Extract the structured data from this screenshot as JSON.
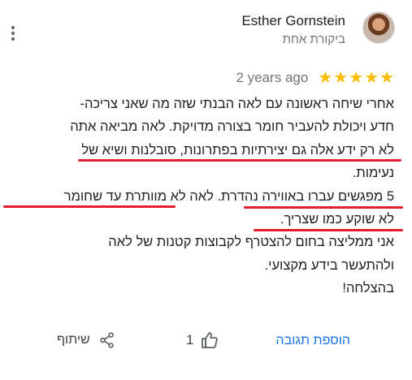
{
  "menu": {
    "icon": "more-vert-icon"
  },
  "author": {
    "name": "Esther Gornstein",
    "meta": "ביקורת אחת",
    "avatar": "avatar-photo"
  },
  "rating": {
    "time": "2 years ago",
    "stars": 5,
    "max_stars": 5,
    "star_color": "#fbbc04"
  },
  "review": {
    "lines": [
      "אחרי שיחה  ראשונה עם לאה הבנתי שזה מה שאני צריכה-",
      "חדע ויכולת להעביר חומר בצורה מדויקת. לאה מביאה אתה",
      "לא רק ידע אלה גם יצירתיות בפתרונות, סובלנות ושיא של",
      "נעימות.",
      "5 מפגשים עברו באווירה נהדרת. לאה לא מוותרת עד שחומר",
      "לא שוקע כמו שצריך.",
      "אני ממליצה בחום להצטרף לקבוצות קטנות של לאה",
      "ולהתעשר בידע מקצועי.",
      "בהצלחה!"
    ],
    "highlight_color": "#e0202d"
  },
  "actions": {
    "reply_label": "הוספת תגובה",
    "like_count": "1",
    "share_label": "שיתוף",
    "accent_color": "#1a73e8"
  }
}
